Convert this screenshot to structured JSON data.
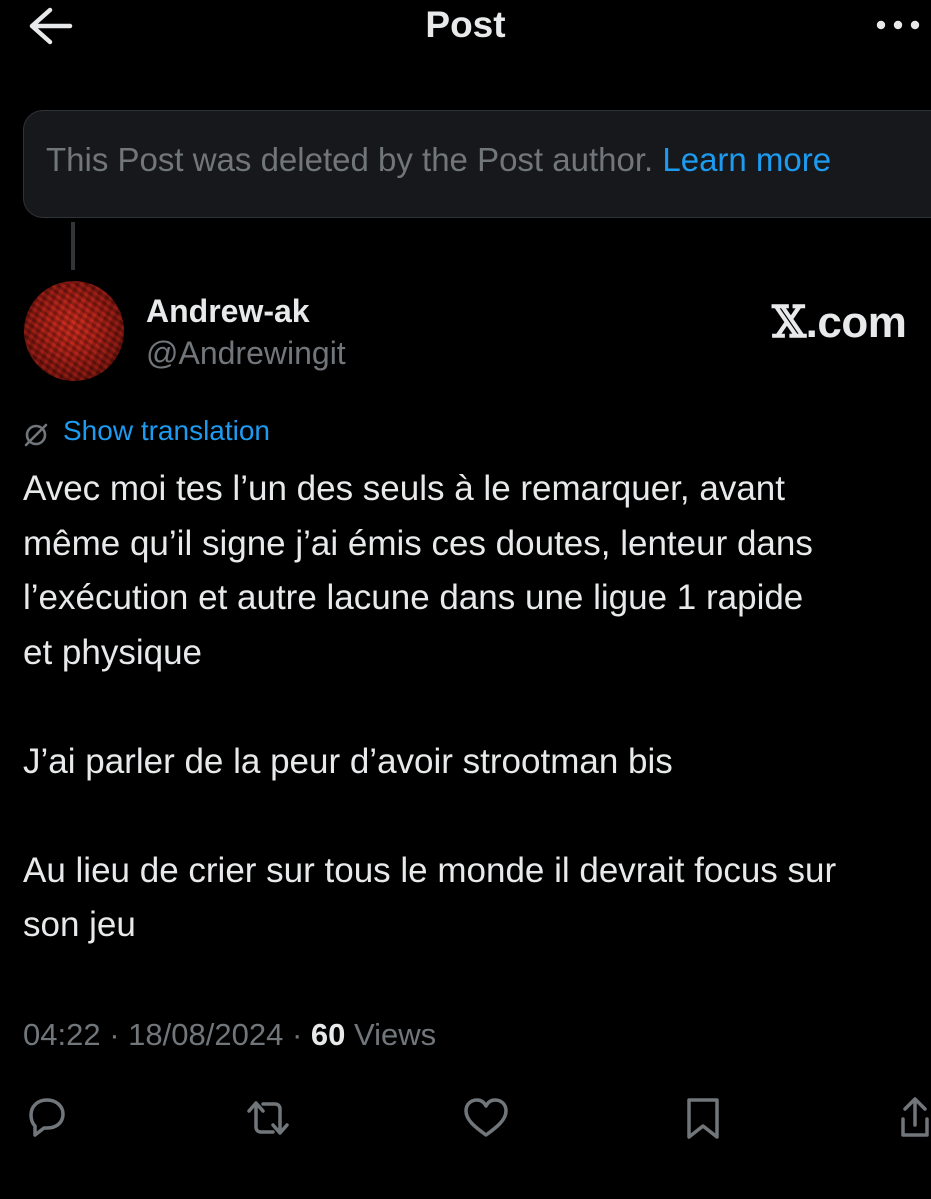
{
  "header": {
    "title": "Post",
    "back_icon": "arrow-left-icon",
    "more_icon": "more-horizontal-icon"
  },
  "deleted_notice": {
    "text": "This Post was deleted by the Post author.",
    "link": "Learn more"
  },
  "author": {
    "name": "Andrew-ak",
    "handle": "@Andrewingit"
  },
  "watermark": {
    "logo": "𝕏",
    "suffix": ".com"
  },
  "translation": {
    "icon": "globe-slash-icon",
    "label": "Show translation"
  },
  "post": {
    "paragraphs": [
      [
        "Avec moi tes l’un des seuls à le remarquer, avant",
        "même qu’il signe j’ai émis ces doutes, lenteur dans",
        "l’exécution et autre lacune dans une ligue 1 rapide",
        "et physique"
      ],
      [
        "J’ai parler de la peur d’avoir strootman bis"
      ],
      [
        "Au lieu de crier sur tous le monde il devrait focus sur",
        "son jeu"
      ]
    ]
  },
  "meta": {
    "time": "04:22",
    "date": "18/08/2024",
    "separator": "·",
    "views_count": "60",
    "views_label": "Views"
  },
  "actions": [
    "reply-icon",
    "repost-icon",
    "like-icon",
    "bookmark-icon",
    "share-icon"
  ],
  "colors": {
    "background": "#000000",
    "text": "#e7e9ea",
    "muted": "#71767b",
    "accent": "#1d9bf0",
    "notice_bg": "#16181c",
    "border": "#2f3336"
  }
}
